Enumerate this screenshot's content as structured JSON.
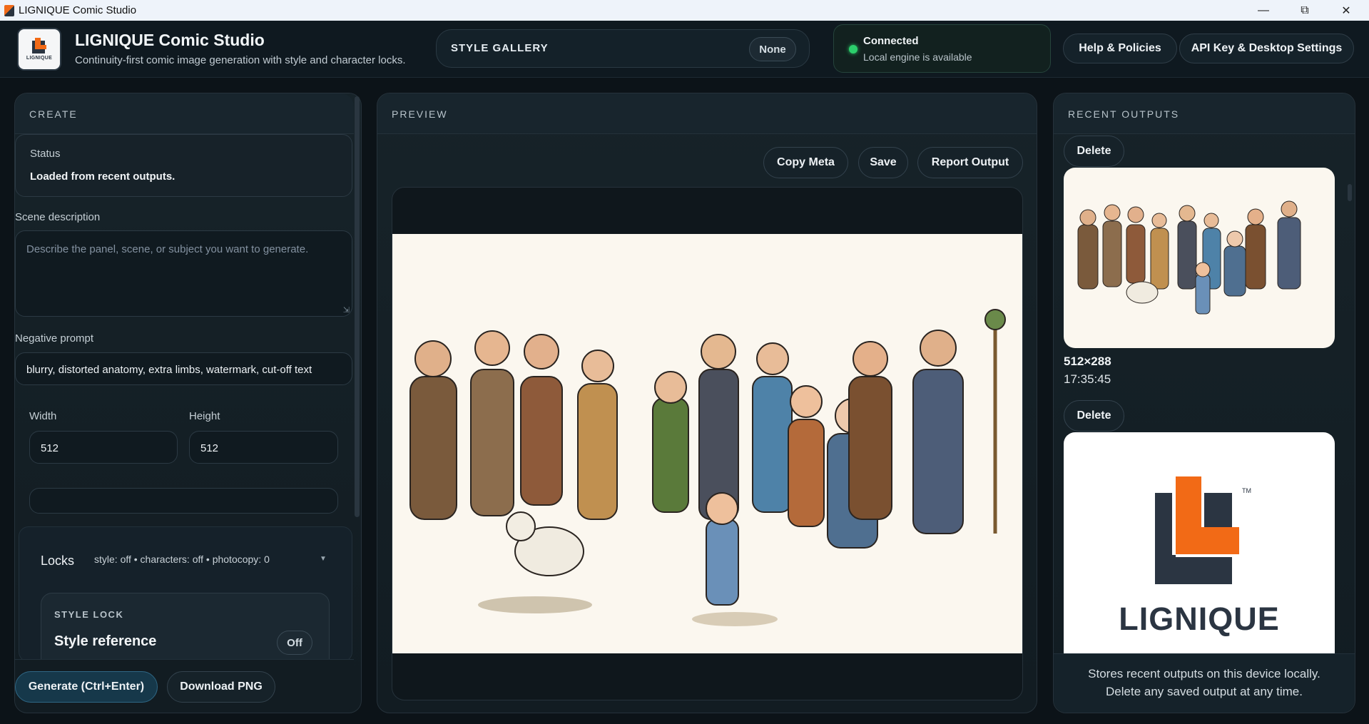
{
  "window": {
    "title": "LIGNIQUE Comic Studio"
  },
  "header": {
    "logo_text": "LIGNIQUE",
    "title": "LIGNIQUE Comic Studio",
    "subtitle": "Continuity-first comic image generation with style and character locks.",
    "style_gallery_label": "STYLE GALLERY",
    "style_gallery_value": "None",
    "connection_title": "Connected",
    "connection_sub": "Local engine is available",
    "help_label": "Help & Policies",
    "settings_label": "API Key & Desktop Settings"
  },
  "create": {
    "heading": "CREATE",
    "status_label": "Status",
    "status_value": "Loaded from recent outputs.",
    "scene_label": "Scene description",
    "scene_placeholder": "Describe the panel, scene, or subject you want to generate.",
    "negative_label": "Negative prompt",
    "negative_value": "blurry, distorted anatomy, extra limbs, watermark, cut-off text",
    "width_label": "Width",
    "width_value": "512",
    "height_label": "Height",
    "height_value": "512",
    "locks_label": "Locks",
    "locks_summary": "style: off • characters: off • photocopy: 0",
    "style_lock_heading": "STYLE LOCK",
    "style_reference_label": "Style reference",
    "style_toggle": "Off",
    "generate_label": "Generate (Ctrl+Enter)",
    "download_label": "Download PNG"
  },
  "preview": {
    "heading": "PREVIEW",
    "copy_meta": "Copy Meta",
    "save": "Save",
    "report": "Report Output"
  },
  "recent": {
    "heading": "RECENT OUTPUTS",
    "items": [
      {
        "delete_label": "Delete",
        "size": "512×288",
        "time": "17:35:45"
      },
      {
        "delete_label": "Delete",
        "logo_text": "LIGNIQUE",
        "tm": "TM"
      }
    ],
    "footer_line1": "Stores recent outputs on this device locally.",
    "footer_line2": "Delete any saved output at any time."
  }
}
